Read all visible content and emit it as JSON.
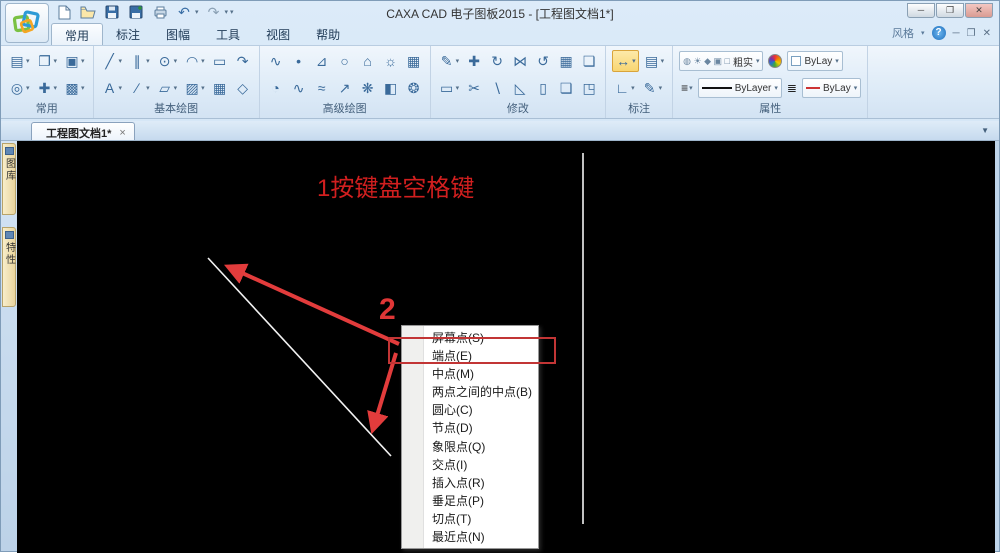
{
  "window": {
    "title": "CAXA CAD 电子图板2015 - [工程图文档1*]"
  },
  "titlebar_controls": {
    "minimize": "─",
    "restore": "❐",
    "close": "✕"
  },
  "quick_access": {
    "undo_glyph": "↶",
    "redo_glyph": "↷",
    "overflow_glyph": "▾"
  },
  "ribbon": {
    "tabs": [
      {
        "label": "常用",
        "active": true
      },
      {
        "label": "标注",
        "active": false
      },
      {
        "label": "图幅",
        "active": false
      },
      {
        "label": "工具",
        "active": false
      },
      {
        "label": "视图",
        "active": false
      },
      {
        "label": "帮助",
        "active": false
      }
    ],
    "style_label": "风格",
    "help_glyph": "?",
    "groups": [
      {
        "label": "常用",
        "rows": [
          [
            {
              "n": "paste-button",
              "g": "▤",
              "d": 1
            },
            {
              "n": "copy-button",
              "g": "❐",
              "d": 1
            },
            {
              "n": "render-button",
              "g": "▣",
              "d": 1
            }
          ],
          [
            {
              "n": "zoom-button",
              "g": "◎",
              "d": 1
            },
            {
              "n": "pan-button",
              "g": "✚",
              "d": 1
            },
            {
              "n": "fill-button",
              "g": "▩",
              "d": 1
            }
          ]
        ]
      },
      {
        "label": "基本绘图",
        "rows": [
          [
            {
              "n": "line-button",
              "g": "╱",
              "d": 1
            },
            {
              "n": "parallel-button",
              "g": "∥",
              "d": 1
            },
            {
              "n": "circle-button",
              "g": "⊙",
              "d": 1
            },
            {
              "n": "arc-button",
              "g": "◠",
              "d": 1
            },
            {
              "n": "rectangle-button",
              "g": "▭",
              "d": 0
            },
            {
              "n": "revolve-button",
              "g": "↷",
              "d": 0
            }
          ],
          [
            {
              "n": "text-button",
              "g": "A",
              "d": 1
            },
            {
              "n": "centerline-button",
              "g": "∕",
              "d": 1
            },
            {
              "n": "block-button",
              "g": "▱",
              "d": 1
            },
            {
              "n": "hatch-button",
              "g": "▨",
              "d": 1
            },
            {
              "n": "crop-button",
              "g": "▦",
              "d": 0
            },
            {
              "n": "region-button",
              "g": "◇",
              "d": 0
            }
          ]
        ]
      },
      {
        "label": "高级绘图",
        "rows": [
          [
            {
              "n": "spline-button",
              "g": "∿",
              "d": 0
            },
            {
              "n": "point-button",
              "g": "•",
              "d": 0
            },
            {
              "n": "angleline-button",
              "g": "⊿",
              "d": 0
            },
            {
              "n": "ellipse-button",
              "g": "○",
              "d": 0
            },
            {
              "n": "polygon-button",
              "g": "⌂",
              "d": 0
            },
            {
              "n": "gear-button",
              "g": "☼",
              "d": 0
            },
            {
              "n": "formula-button",
              "g": "▦",
              "d": 0
            }
          ],
          [
            {
              "n": "pie-button",
              "g": "◔",
              "d": 0
            },
            {
              "n": "wave-button",
              "g": "∿",
              "d": 0
            },
            {
              "n": "sample-button",
              "g": "≈",
              "d": 0
            },
            {
              "n": "arrow-draw-button",
              "g": "↗",
              "d": 0
            },
            {
              "n": "contour-button",
              "g": "❋",
              "d": 0
            },
            {
              "n": "hole-button",
              "g": "◧",
              "d": 0
            },
            {
              "n": "cloud-button",
              "g": "❂",
              "d": 0
            }
          ]
        ]
      },
      {
        "label": "修改",
        "rows": [
          [
            {
              "n": "erase-button",
              "g": "✎",
              "d": 1
            },
            {
              "n": "move-button",
              "g": "✚",
              "d": 0
            },
            {
              "n": "rotate-button",
              "g": "↻",
              "d": 0
            },
            {
              "n": "mirror-button",
              "g": "⋈",
              "d": 0
            },
            {
              "n": "circular-array-button",
              "g": "↺",
              "d": 0
            },
            {
              "n": "array-button",
              "g": "▦",
              "d": 0
            },
            {
              "n": "offset-button",
              "g": "❏",
              "d": 0
            }
          ],
          [
            {
              "n": "select-button",
              "g": "▭",
              "d": 1
            },
            {
              "n": "trim-button",
              "g": "✂",
              "d": 0
            },
            {
              "n": "extend-button",
              "g": "∖",
              "d": 0
            },
            {
              "n": "chamfer-button",
              "g": "◺",
              "d": 0
            },
            {
              "n": "stretch-button",
              "g": "▯",
              "d": 0
            },
            {
              "n": "copy-stack-button",
              "g": "❏",
              "d": 0
            },
            {
              "n": "corner-button",
              "g": "◳",
              "d": 0
            }
          ]
        ]
      },
      {
        "label": "标注",
        "rows": [
          [
            {
              "n": "dimension-button",
              "g": "↔",
              "d": 1,
              "hl": 1
            },
            {
              "n": "text-dim-button",
              "g": "▤",
              "d": 1
            }
          ],
          [
            {
              "n": "coord-dim-button",
              "g": "∟",
              "d": 1
            },
            {
              "n": "edit-dim-button",
              "g": "✎",
              "d": 1
            }
          ]
        ]
      }
    ]
  },
  "properties": {
    "group_label": "属性",
    "layer_state_icons": "◍ ☀ ◆ ▣ □",
    "layer_value": "粗实",
    "linetype_value": "ByLayer",
    "color_value": "ByLay",
    "linewidth_value": "ByLay"
  },
  "document_tabs": {
    "active_label": "工程图文档1*",
    "close_glyph": "×",
    "overflow_glyph": "▼"
  },
  "sidebar": {
    "tabs": [
      {
        "label": "图库"
      },
      {
        "label": "特性"
      }
    ]
  },
  "canvas": {
    "step1_label": "1按键盘空格键",
    "step2_label": "2",
    "colors": {
      "annotation_red": "#e23c3c",
      "rect_red": "#c23535",
      "line_white": "#f2f2f2"
    },
    "shapes": {
      "white_lines": [
        [
          191,
          117,
          374,
          315
        ],
        [
          566,
          12,
          566,
          383
        ]
      ],
      "red_arrows": [
        [
          382,
          203,
          212,
          126
        ],
        [
          379,
          212,
          356,
          288
        ]
      ],
      "red_rect": [
        372,
        197,
        166,
        25
      ]
    },
    "context_menu": {
      "items": [
        "屏幕点(S)",
        "端点(E)",
        "中点(M)",
        "两点之间的中点(B)",
        "圆心(C)",
        "节点(D)",
        "象限点(Q)",
        "交点(I)",
        "插入点(R)",
        "垂足点(P)",
        "切点(T)",
        "最近点(N)"
      ],
      "highlighted_item": "端点(E)"
    }
  }
}
